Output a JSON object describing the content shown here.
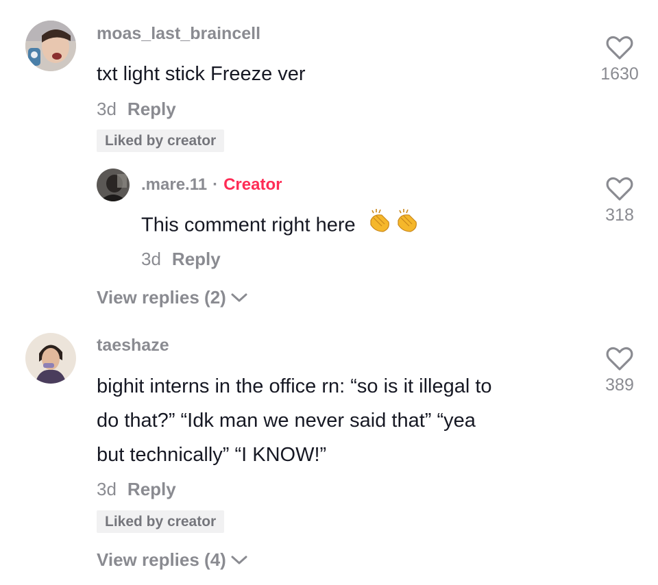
{
  "comments": [
    {
      "username": "moas_last_braincell",
      "text": "txt light stick Freeze ver",
      "time": "3d",
      "reply_label": "Reply",
      "badge": "Liked by creator",
      "likes": "1630"
    },
    {
      "username": "taeshaze",
      "text_lines": [
        "bighit interns in the office rn: “so is it illegal to",
        "do that?” “Idk man we never said that” “yea",
        "but technically” “I KNOW!”"
      ],
      "time": "3d",
      "reply_label": "Reply",
      "badge": "Liked by creator",
      "likes": "389",
      "view_replies": "View replies (4)"
    }
  ],
  "reply": {
    "username": ".mare.11",
    "separator": "·",
    "creator_label": "Creator",
    "text": "This comment right here",
    "emoji": "clapping-hands-emoji",
    "time": "3d",
    "reply_label": "Reply",
    "likes": "318"
  },
  "view_replies_1": "View replies (2)",
  "colors": {
    "username": "#8a8b91",
    "text": "#161823",
    "creator": "#fe2c55",
    "badge_bg": "#f1f1f2"
  }
}
